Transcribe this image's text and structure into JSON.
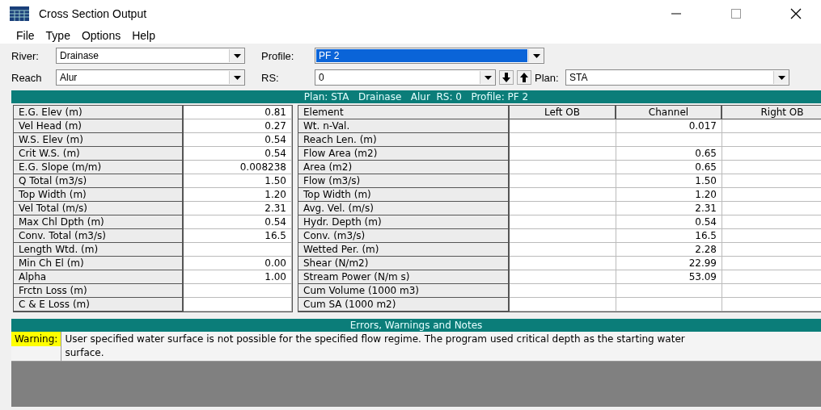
{
  "window": {
    "title": "Cross Section Output"
  },
  "menu": [
    "File",
    "Type",
    "Options",
    "Help"
  ],
  "selectors": [
    {
      "label": "River:",
      "value": "Drainase",
      "highlighted": false
    },
    {
      "label": "Profile:",
      "value": "PF 2",
      "highlighted": true
    },
    {
      "label": "Reach",
      "value": "Alur",
      "highlighted": false
    },
    {
      "label": "RS:",
      "value": "0",
      "highlighted": false
    },
    {
      "label": "Plan:",
      "value": "STA",
      "highlighted": false
    }
  ],
  "table_header": "Plan: STA   Drainase   Alur  RS: 0   Profile: PF 2",
  "left_table": [
    [
      "E.G. Elev (m)",
      "0.81"
    ],
    [
      "Vel Head (m)",
      "0.27"
    ],
    [
      "W.S. Elev (m)",
      "0.54"
    ],
    [
      "Crit W.S. (m)",
      "0.54"
    ],
    [
      "E.G. Slope (m/m)",
      "0.008238"
    ],
    [
      "Q Total (m3/s)",
      "1.50"
    ],
    [
      "Top Width (m)",
      "1.20"
    ],
    [
      "Vel Total (m/s)",
      "2.31"
    ],
    [
      "Max Chl Dpth (m)",
      "0.54"
    ],
    [
      "Conv. Total (m3/s)",
      "16.5"
    ],
    [
      "Length Wtd. (m)"
    ],
    [
      "Min Ch El (m)",
      "0.00"
    ],
    [
      "Alpha",
      "1.00"
    ],
    [
      "Frctn Loss (m)"
    ],
    [
      "C & E Loss (m)"
    ]
  ],
  "right_table": {
    "columns": [
      "Element",
      "Left OB",
      "Channel",
      "Right OB"
    ],
    "rows": [
      [
        "Wt. n-Val.",
        null,
        "0.017",
        null
      ],
      [
        "Reach Len. (m)",
        null,
        null,
        null
      ],
      [
        "Flow Area (m2)",
        null,
        "0.65",
        null
      ],
      [
        "Area (m2)",
        null,
        "0.65",
        null
      ],
      [
        "Flow (m3/s)",
        null,
        "1.50",
        null
      ],
      [
        "Top Width (m)",
        null,
        "1.20",
        null
      ],
      [
        "Avg. Vel. (m/s)",
        null,
        "2.31",
        null
      ],
      [
        "Hydr. Depth (m)",
        null,
        "0.54",
        null
      ],
      [
        "Conv. (m3/s)",
        null,
        "16.5",
        null
      ],
      [
        "Wetted Per. (m)",
        null,
        "2.28",
        null
      ],
      [
        "Shear (N/m2)",
        null,
        "22.99",
        null
      ],
      [
        "Stream Power (N/m s)",
        null,
        "53.09",
        null
      ],
      [
        "Cum Volume (1000 m3)",
        null,
        null,
        null
      ],
      [
        "Cum SA (1000 m2)",
        null,
        null,
        null
      ]
    ]
  },
  "notes": {
    "title": "Errors, Warnings and Notes",
    "items": [
      {
        "type": "Warning:",
        "text": "User specified water surface is not possible for the specified flow regime. The program used critical depth as the starting water surface."
      }
    ]
  }
}
